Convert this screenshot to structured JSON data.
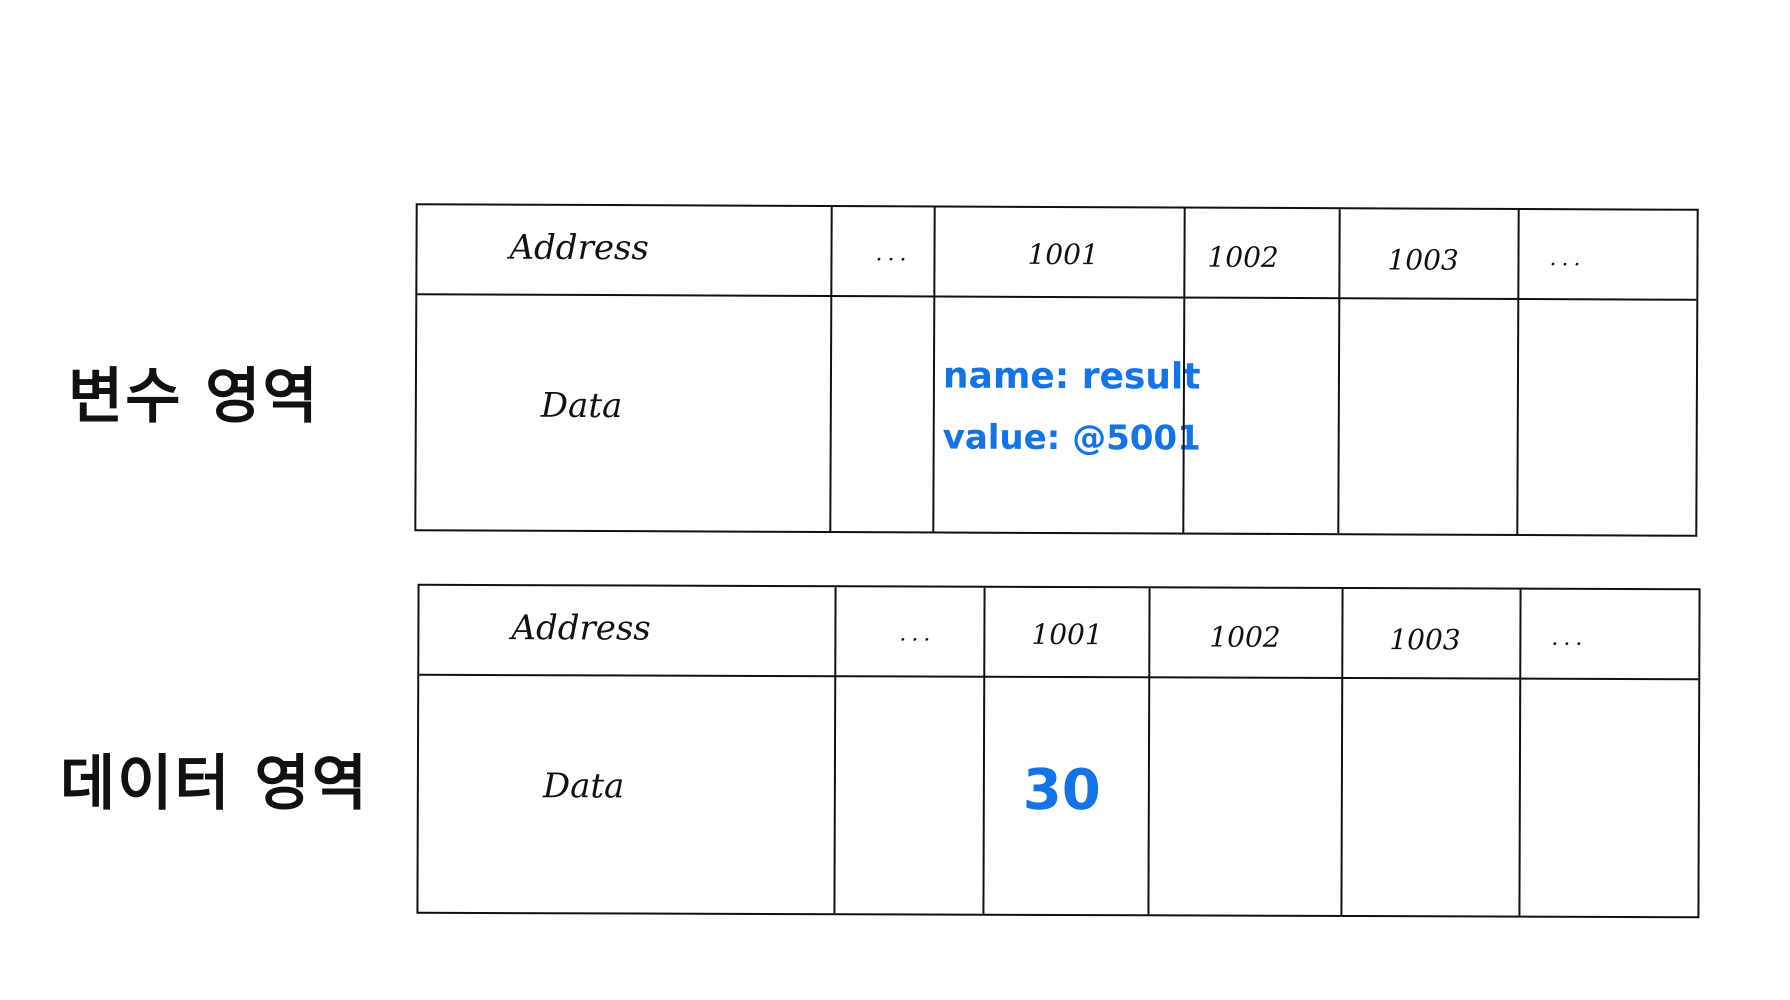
{
  "labels": {
    "variable_area": "변수 영역",
    "data_area": "데이터 영역"
  },
  "variable_table": {
    "row_address_label": "Address",
    "row_data_label": "Data",
    "addresses": [
      "...",
      "1001",
      "1002",
      "1003",
      "..."
    ],
    "cell_1001": {
      "name_line": "name: result",
      "value_line": "value: @5001"
    }
  },
  "data_table": {
    "row_address_label": "Address",
    "row_data_label": "Data",
    "addresses": [
      "...",
      "1001",
      "1002",
      "1003",
      "..."
    ],
    "cell_1001_value": "30"
  },
  "colors": {
    "ink": "#111111",
    "highlight": "#1473e6",
    "ruled_line": "#dedede"
  }
}
